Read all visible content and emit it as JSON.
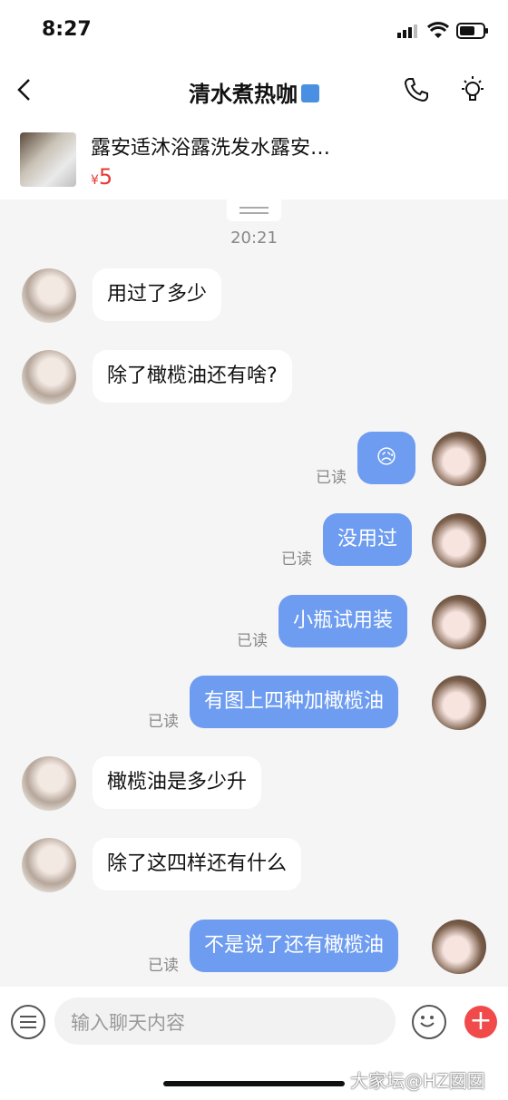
{
  "status_bar": {
    "time": "8:27"
  },
  "header": {
    "title": "清水煮热咖"
  },
  "product": {
    "title": "露安适沐浴露洗发水露安…",
    "currency": "¥",
    "price": "5"
  },
  "chat": {
    "timestamp": "20:21",
    "messages": [
      {
        "side": "left",
        "text": "用过了多少"
      },
      {
        "side": "left",
        "text": "除了橄榄油还有啥?"
      },
      {
        "side": "right",
        "text": "😥",
        "status": "已读"
      },
      {
        "side": "right",
        "text": "没用过",
        "status": "已读"
      },
      {
        "side": "right",
        "text": "小瓶试用装",
        "status": "已读"
      },
      {
        "side": "right",
        "text": "有图上四种加橄榄油",
        "status": "已读"
      },
      {
        "side": "left",
        "text": "橄榄油是多少升"
      },
      {
        "side": "left",
        "text": "除了这四样还有什么"
      },
      {
        "side": "right",
        "text": "不是说了还有橄榄油",
        "status": "已读"
      }
    ]
  },
  "input_bar": {
    "placeholder": "输入聊天内容"
  },
  "watermark": "大家坛@HZ囡囡",
  "colors": {
    "accent": "#6d9cf0",
    "price": "#e53935",
    "plus": "#f04a4a"
  }
}
